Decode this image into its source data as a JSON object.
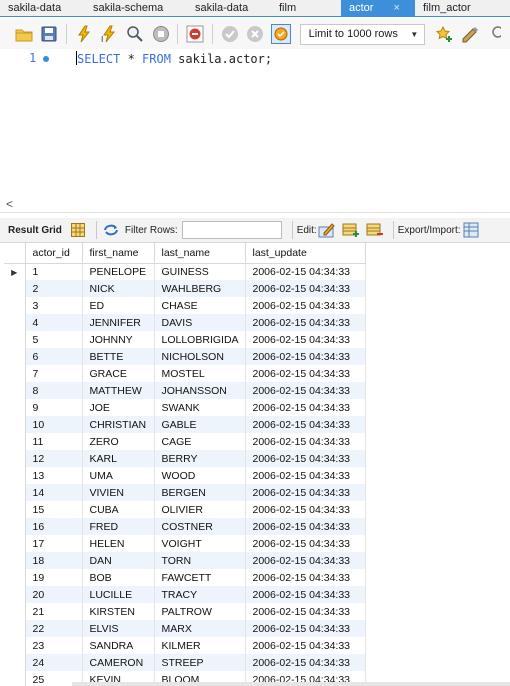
{
  "tabs": [
    {
      "label": "sakila-data",
      "active": false
    },
    {
      "label": "sakila-schema",
      "active": false
    },
    {
      "label": "sakila-data",
      "active": false
    },
    {
      "label": "film",
      "active": false
    },
    {
      "label": "actor",
      "active": true
    },
    {
      "label": "film_actor",
      "active": false
    }
  ],
  "tab_close_glyph": "×",
  "toolbar": {
    "limit_label": "Limit to 1000 rows"
  },
  "editor": {
    "line_number": "1",
    "kw_select": "SELECT",
    "star": " * ",
    "kw_from": "FROM",
    "rest": " sakila.actor;"
  },
  "scroll_left_glyph": "<",
  "result_toolbar": {
    "result_grid": "Result Grid",
    "filter_rows": "Filter Rows:",
    "filter_value": "",
    "edit": "Edit:",
    "export_import": "Export/Import:"
  },
  "grid": {
    "columns": [
      "actor_id",
      "first_name",
      "last_name",
      "last_update"
    ],
    "rows": [
      [
        "1",
        "PENELOPE",
        "GUINESS",
        "2006-02-15 04:34:33"
      ],
      [
        "2",
        "NICK",
        "WAHLBERG",
        "2006-02-15 04:34:33"
      ],
      [
        "3",
        "ED",
        "CHASE",
        "2006-02-15 04:34:33"
      ],
      [
        "4",
        "JENNIFER",
        "DAVIS",
        "2006-02-15 04:34:33"
      ],
      [
        "5",
        "JOHNNY",
        "LOLLOBRIGIDA",
        "2006-02-15 04:34:33"
      ],
      [
        "6",
        "BETTE",
        "NICHOLSON",
        "2006-02-15 04:34:33"
      ],
      [
        "7",
        "GRACE",
        "MOSTEL",
        "2006-02-15 04:34:33"
      ],
      [
        "8",
        "MATTHEW",
        "JOHANSSON",
        "2006-02-15 04:34:33"
      ],
      [
        "9",
        "JOE",
        "SWANK",
        "2006-02-15 04:34:33"
      ],
      [
        "10",
        "CHRISTIAN",
        "GABLE",
        "2006-02-15 04:34:33"
      ],
      [
        "11",
        "ZERO",
        "CAGE",
        "2006-02-15 04:34:33"
      ],
      [
        "12",
        "KARL",
        "BERRY",
        "2006-02-15 04:34:33"
      ],
      [
        "13",
        "UMA",
        "WOOD",
        "2006-02-15 04:34:33"
      ],
      [
        "14",
        "VIVIEN",
        "BERGEN",
        "2006-02-15 04:34:33"
      ],
      [
        "15",
        "CUBA",
        "OLIVIER",
        "2006-02-15 04:34:33"
      ],
      [
        "16",
        "FRED",
        "COSTNER",
        "2006-02-15 04:34:33"
      ],
      [
        "17",
        "HELEN",
        "VOIGHT",
        "2006-02-15 04:34:33"
      ],
      [
        "18",
        "DAN",
        "TORN",
        "2006-02-15 04:34:33"
      ],
      [
        "19",
        "BOB",
        "FAWCETT",
        "2006-02-15 04:34:33"
      ],
      [
        "20",
        "LUCILLE",
        "TRACY",
        "2006-02-15 04:34:33"
      ],
      [
        "21",
        "KIRSTEN",
        "PALTROW",
        "2006-02-15 04:34:33"
      ],
      [
        "22",
        "ELVIS",
        "MARX",
        "2006-02-15 04:34:33"
      ],
      [
        "23",
        "SANDRA",
        "KILMER",
        "2006-02-15 04:34:33"
      ],
      [
        "24",
        "CAMERON",
        "STREEP",
        "2006-02-15 04:34:33"
      ],
      [
        "25",
        "KEVIN",
        "BLOOM",
        "2006-02-15 04:34:33"
      ]
    ],
    "current_row_glyph": "▶"
  },
  "colors": {
    "active_tab": "#3c8fd8",
    "keyword": "#3a6fdc",
    "row_alt": "#eef4fb"
  },
  "icons": [
    "folder-open-icon",
    "save-icon",
    "execute-icon",
    "execute-current-icon",
    "explain-icon",
    "stop-icon",
    "toggle-continue-icon",
    "commit-icon",
    "rollback-icon",
    "autocommit-icon",
    "bookmark-icon",
    "beautify-icon",
    "find-icon",
    "grid-layout-icon",
    "refresh-icon",
    "edit-row-icon",
    "add-row-icon",
    "delete-row-icon",
    "export-icon"
  ]
}
